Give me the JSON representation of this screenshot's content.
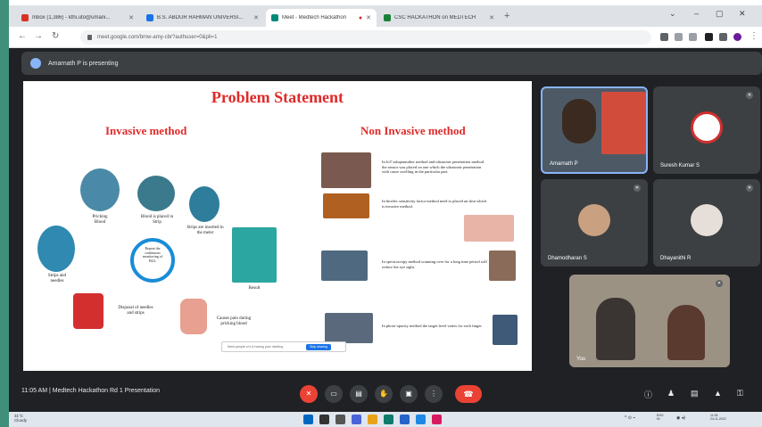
{
  "browser": {
    "tabs": [
      {
        "label": "Inbox (1,386) - kthi.uto@umani...",
        "active": false,
        "color": "#d93025"
      },
      {
        "label": "B.S. ABDUR RAHMAN UNIVERSI...",
        "active": false,
        "color": "#1a73e8"
      },
      {
        "label": "Meet - Medtech Hackathon",
        "active": true,
        "color": "#00897b"
      },
      {
        "label": "CSC HACKATHON on MEDTECH",
        "active": false,
        "color": "#188038"
      }
    ],
    "new_tab": "+",
    "window_controls": [
      "⌄",
      "–",
      "▢",
      "✕"
    ],
    "url": "meet.google.com/bmw-amy-cbr?authuser=0&pli=1"
  },
  "presenter": {
    "text": "Amarnath P is presenting"
  },
  "slide": {
    "title": "Problem Statement",
    "left_heading": "Invasive method",
    "right_heading": "Non Invasive method",
    "captions": {
      "pricking": "Pricking\nBlood",
      "strip": "Blood is placed in\nStrip",
      "inserted": "Strips are inserted in\nthe meter",
      "strips_needles": "Strips and\nneedles",
      "repeat": "Repeat the\ncontinuous\nmonitoring of\nBGL",
      "result": "Result",
      "disposal": "Disposal of needles\nand strips",
      "pain": "Causes pain during\npricking blood"
    },
    "descriptions": [
      "In IoT subquanutbor method and ultrasonic penetration method the sensor was placed on one which the ultrasonic penetration with cause swelling in the particular part.",
      "In bioelec sensitivity factor method need to placed an skin which is invasive method.",
      "In spectroscopy method scanning over for a long time period will reduce the eye sight.",
      "In photo-opacity method the target level varies for each finger."
    ],
    "chat_placeholder": "Send people a hi & having your meeting",
    "chat_button": "Stop sharing"
  },
  "participants": [
    {
      "name": "Amarnath P",
      "type": "video"
    },
    {
      "name": "Suresh Kumar S",
      "type": "avatar"
    },
    {
      "name": "Dhamodharan S",
      "type": "avatar"
    },
    {
      "name": "Dhayanithi R",
      "type": "avatar"
    },
    {
      "name": "You",
      "type": "video"
    }
  ],
  "meeting": {
    "time": "11:05 AM",
    "separator": "|",
    "title": "Medtech Hackathon Rd 1 Presentation"
  },
  "taskbar": {
    "weather_temp": "31°C",
    "weather_desc": "Cloudy",
    "lang": "ENG\nIN",
    "clock": "11:05\n24-11-2022"
  }
}
